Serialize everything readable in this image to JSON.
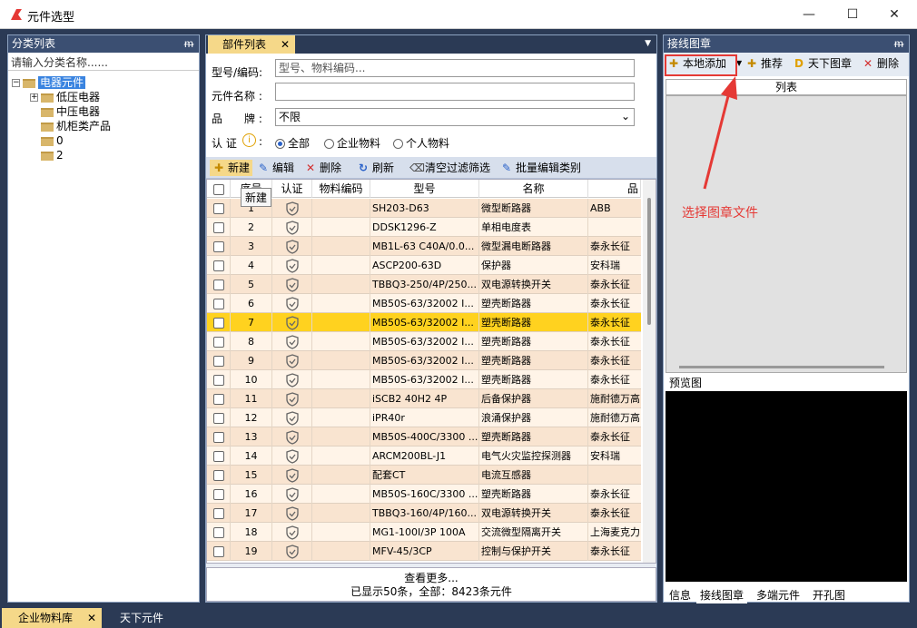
{
  "window": {
    "title": "元件选型",
    "minimize": "—",
    "maximize": "☐",
    "close": "✕"
  },
  "left": {
    "title": "分类列表",
    "pin": "ᵯ",
    "search_placeholder": "请输入分类名称......",
    "tree": {
      "root": "电器元件",
      "children": [
        "低压电器",
        "中压电器",
        "机柜类产品",
        "0",
        "2"
      ]
    }
  },
  "middle": {
    "tab": "部件列表",
    "tab_close": "✕",
    "form": {
      "model_label": "型号/编码:",
      "model_placeholder": "型号、物料编码...",
      "name_label": "元件名称 :",
      "brand_label": "品　　牌 :",
      "brand_value": "不限",
      "cert_label": "认 证",
      "cert_all": "全部",
      "cert_ent": "企业物料",
      "cert_personal": "个人物料"
    },
    "toolbar": {
      "new": "新建",
      "edit": "编辑",
      "delete": "删除",
      "refresh": "刷新",
      "clear": "清空过滤筛选",
      "batch": "批量编辑类别"
    },
    "tooltip": "新建",
    "columns": [
      "序号",
      "认证",
      "物料编码",
      "型号",
      "名称",
      "品"
    ],
    "rows": [
      {
        "no": "1",
        "model": "SH203-D63",
        "name": "微型断路器",
        "brand": "ABB"
      },
      {
        "no": "2",
        "model": "DDSK1296-Z",
        "name": "单相电度表",
        "brand": ""
      },
      {
        "no": "3",
        "model": "MB1L-63 C40A/0.0...",
        "name": "微型漏电断路器",
        "brand": "泰永长征"
      },
      {
        "no": "4",
        "model": "ASCP200-63D",
        "name": "保护器",
        "brand": "安科瑞"
      },
      {
        "no": "5",
        "model": "TBBQ3-250/4P/250...",
        "name": "双电源转换开关",
        "brand": "泰永长征"
      },
      {
        "no": "6",
        "model": "MB50S-63/32002 I...",
        "name": "塑壳断路器",
        "brand": "泰永长征"
      },
      {
        "no": "7",
        "model": "MB50S-63/32002 I...",
        "name": "塑壳断路器",
        "brand": "泰永长征"
      },
      {
        "no": "8",
        "model": "MB50S-63/32002 I...",
        "name": "塑壳断路器",
        "brand": "泰永长征"
      },
      {
        "no": "9",
        "model": "MB50S-63/32002 I...",
        "name": "塑壳断路器",
        "brand": "泰永长征"
      },
      {
        "no": "10",
        "model": "MB50S-63/32002 I...",
        "name": "塑壳断路器",
        "brand": "泰永长征"
      },
      {
        "no": "11",
        "model": "iSCB2 40H2 4P",
        "name": "后备保护器",
        "brand": "施耐德万高"
      },
      {
        "no": "12",
        "model": "iPR40r",
        "name": "浪涌保护器",
        "brand": "施耐德万高"
      },
      {
        "no": "13",
        "model": "MB50S-400C/3300 ...",
        "name": "塑壳断路器",
        "brand": "泰永长征"
      },
      {
        "no": "14",
        "model": "ARCM200BL-J1",
        "name": "电气火灾监控探测器",
        "brand": "安科瑞"
      },
      {
        "no": "15",
        "model": "配套CT",
        "name": "电流互感器",
        "brand": ""
      },
      {
        "no": "16",
        "model": "MB50S-160C/3300 ...",
        "name": "塑壳断路器",
        "brand": "泰永长征"
      },
      {
        "no": "17",
        "model": "TBBQ3-160/4P/160...",
        "name": "双电源转换开关",
        "brand": "泰永长征"
      },
      {
        "no": "18",
        "model": "MG1-100I/3P 100A",
        "name": "交流微型隔离开关",
        "brand": "上海麦克力"
      },
      {
        "no": "19",
        "model": "MFV-45/3CP",
        "name": "控制与保护开关",
        "brand": "泰永长征"
      }
    ],
    "selected_row": 7,
    "more": "查看更多...",
    "count": "已显示50条，全部：8423条元件"
  },
  "right": {
    "title": "接线图章",
    "pin": "ᵯ",
    "local_add": "本地添加",
    "recommend": "推荐",
    "world": "天下图章",
    "delete": "删除",
    "list_header": "列表",
    "preview": "预览图",
    "tabs": [
      "信息",
      "接线图章",
      "多端元件",
      "开孔图"
    ],
    "active_tab": 1
  },
  "bottom": {
    "tabs": [
      "企业物料库",
      "天下元件"
    ],
    "close": "✕"
  },
  "annotation": "选择图章文件",
  "colors": {
    "accent": "#f5d889",
    "selected": "#ffd21f",
    "row_odd": "#f9e4d0",
    "row_even": "#fff4e8",
    "annot": "#e53935"
  }
}
